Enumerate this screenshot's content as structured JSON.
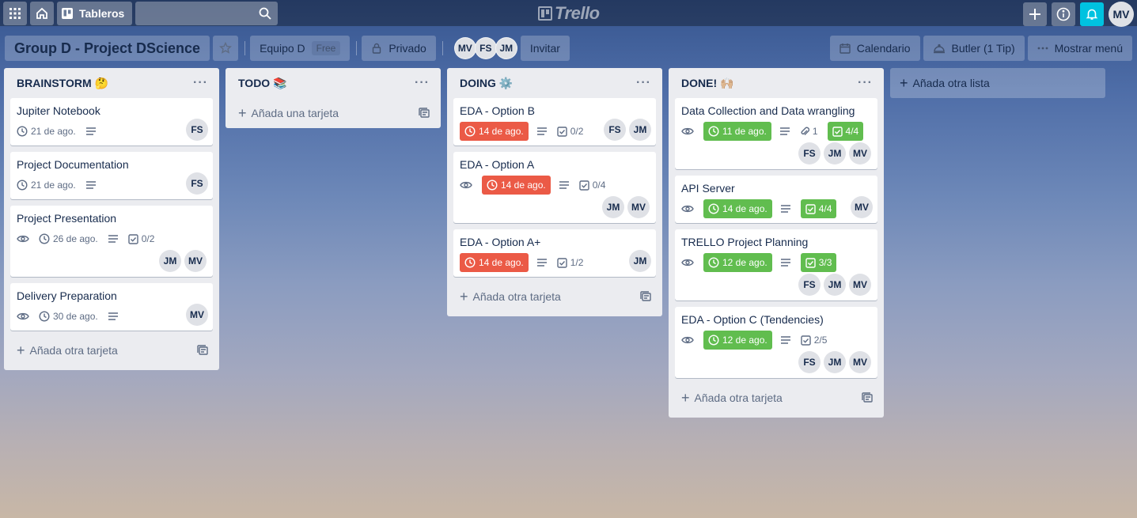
{
  "header": {
    "apps_icon": "grid-icon",
    "home_icon": "home-icon",
    "boards_label": "Tableros",
    "search_placeholder": "",
    "logo_text": "Trello",
    "initials": "MV"
  },
  "board": {
    "title": "Group D - Project DScience",
    "team": "Equipo D",
    "team_badge": "Free",
    "visibility": "Privado",
    "members": [
      "MV",
      "FS",
      "JM"
    ],
    "invite": "Invitar",
    "calendar": "Calendario",
    "butler": "Butler (1 Tip)",
    "menu": "Mostrar menú"
  },
  "lists": [
    {
      "title": "BRAINSTORM 🤔",
      "add_label": "Añada otra tarjeta",
      "cards": [
        {
          "title": "Jupiter Notebook",
          "due": "21 de ago.",
          "members": [
            "FS"
          ]
        },
        {
          "title": "Project Documentation",
          "due": "21 de ago.",
          "members": [
            "FS"
          ]
        },
        {
          "title": "Project Presentation",
          "due": "26 de ago.",
          "checklist": "0/2",
          "members": [
            "JM",
            "MV"
          ]
        },
        {
          "title": "Delivery Preparation",
          "due": "30 de ago.",
          "members": [
            "MV"
          ]
        }
      ]
    },
    {
      "title": "TODO 📚",
      "add_label": "Añada una tarjeta",
      "cards": []
    },
    {
      "title": "DOING ⚙️",
      "add_label": "Añada otra tarjeta",
      "cards": [
        {
          "title": "EDA - Option B",
          "due": "14 de ago.",
          "checklist": "0/2",
          "members": [
            "FS",
            "JM"
          ]
        },
        {
          "title": "EDA - Option A",
          "due": "14 de ago.",
          "checklist": "0/4",
          "members": [
            "JM",
            "MV"
          ]
        },
        {
          "title": "EDA - Option A+",
          "due": "14 de ago.",
          "checklist": "1/2",
          "members": [
            "JM"
          ]
        }
      ]
    },
    {
      "title": "DONE! 🙌🏼",
      "add_label": "Añada otra tarjeta",
      "cards": [
        {
          "title": "Data Collection and Data wrangling",
          "due": "11 de ago.",
          "attachments": "1",
          "checklist": "4/4",
          "members": [
            "FS",
            "JM",
            "MV"
          ]
        },
        {
          "title": "API Server",
          "due": "14 de ago.",
          "checklist": "4/4",
          "members": [
            "MV"
          ]
        },
        {
          "title": "TRELLO Project Planning",
          "due": "12 de ago.",
          "checklist": "3/3",
          "members": [
            "FS",
            "JM",
            "MV"
          ]
        },
        {
          "title": "EDA - Option C (Tendencies)",
          "due": "12 de ago.",
          "checklist": "2/5",
          "members": [
            "FS",
            "JM",
            "MV"
          ]
        }
      ]
    }
  ],
  "add_list_label": "Añada otra lista",
  "colors": {
    "due_overdue": "#eb5a46",
    "complete": "#61bd4f",
    "notification": "#00c2e0"
  }
}
